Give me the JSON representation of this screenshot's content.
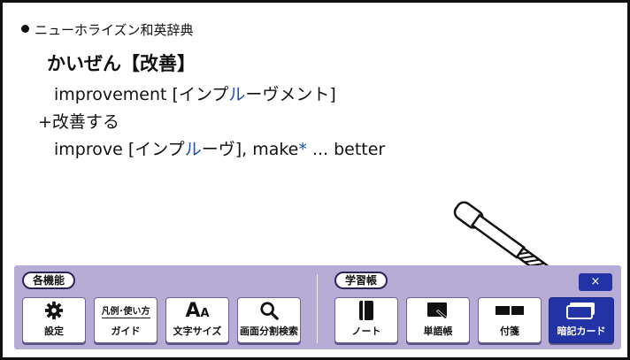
{
  "dictionary": {
    "name": "ニューホライズン和英辞典",
    "headword": "かいぜん【改善】",
    "entries": [
      {
        "pre": "improvement [インプ",
        "accent": "ル",
        "post": "ーヴメント]"
      },
      {
        "phrase": "+改善する"
      },
      {
        "pre": "improve [インプ",
        "accent": "ル",
        "post": "ーヴ], make",
        "star": "*",
        "tail": " ... better"
      }
    ]
  },
  "panel": {
    "group_functions_label": "各機能",
    "group_study_label": "学習帳",
    "close_label": "×",
    "buttons": {
      "settings": {
        "label": "設定",
        "icon": "gear-icon"
      },
      "guide": {
        "top": "凡例･使い方",
        "label": "ガイド",
        "icon": "guide-icon"
      },
      "font_size": {
        "label": "文字サイズ",
        "icon": "font-size-icon",
        "glyph_big": "A",
        "glyph_small": "A"
      },
      "split_search": {
        "label": "画面分割検索",
        "icon": "search-icon"
      },
      "note": {
        "label": "ノート",
        "icon": "notebook-icon"
      },
      "wordbook": {
        "label": "単語帳",
        "icon": "wordbook-icon"
      },
      "sticky": {
        "label": "付箋",
        "icon": "sticky-note-icon"
      },
      "flashcard": {
        "label": "暗記カード",
        "icon": "flashcard-icon",
        "active": true
      }
    }
  },
  "colors": {
    "panel": "#b7acd6",
    "accent_blue": "#2233a6",
    "text_accent": "#1a4fb0"
  }
}
